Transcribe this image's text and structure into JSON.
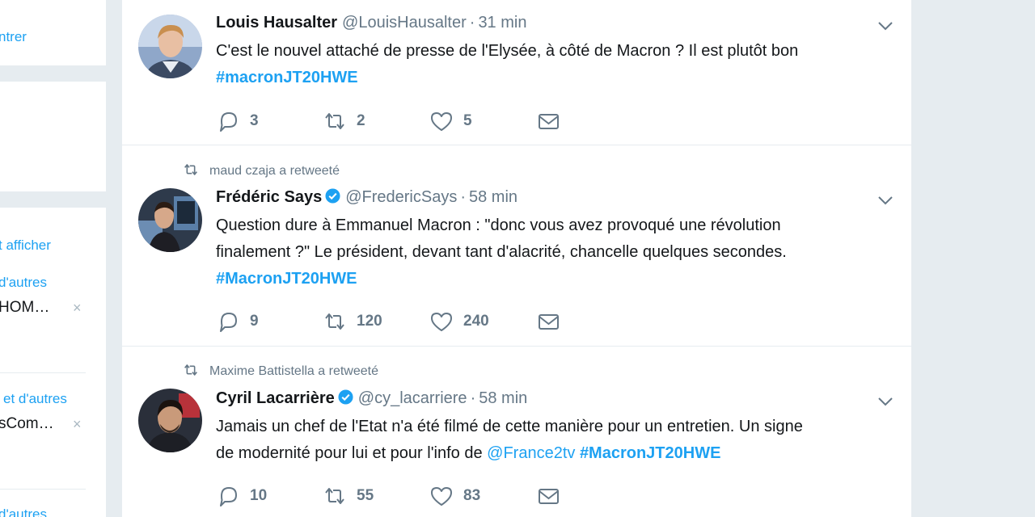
{
  "sidebar": {
    "card1": {
      "link": "ntrer"
    },
    "card3": {
      "link_show": "t afficher",
      "item1_meta": "d'autres",
      "item1_name": "HOM…",
      "item2_meta": "et d'autres",
      "item2_name": "sCom…",
      "item3_meta": "d'autres",
      "dismiss": "×"
    }
  },
  "tweets": [
    {
      "retweeted_by": "",
      "name": "Louis Hausalter",
      "verified": false,
      "handle": "@LouisHausalter",
      "time": "31 min",
      "text_lines": [
        "C'est le nouvel attaché de presse de l'Elysée, à côté de Macron ? Il est plutôt bon"
      ],
      "hashtag": "#macronJT20HWE",
      "replies": "3",
      "retweets": "2",
      "likes": "5"
    },
    {
      "retweeted_by": "maud czaja a retweeté",
      "name": "Frédéric Says",
      "verified": true,
      "handle": "@FredericSays",
      "time": "58 min",
      "text_lines": [
        "Question dure à Emmanuel Macron : \"donc vous avez provoqué une révolution",
        "finalement ?\" Le président, devant tant d'alacrité, chancelle quelques secondes."
      ],
      "hashtag": "#MacronJT20HWE",
      "replies": "9",
      "retweets": "120",
      "likes": "240"
    },
    {
      "retweeted_by": "Maxime Battistella a retweeté",
      "name": "Cyril Lacarrière",
      "verified": true,
      "handle": "@cy_lacarriere",
      "time": "58 min",
      "text_line1": "Jamais un chef de l'Etat n'a été filmé de cette manière pour un entretien. Un signe",
      "text_line2_pre": "de modernité pour lui et pour l'info de ",
      "mention": "@France2tv",
      "hashtag": "#MacronJT20HWE",
      "replies": "10",
      "retweets": "55",
      "likes": "83"
    }
  ],
  "separator": "·",
  "colors": {
    "accent": "#1da1f2",
    "muted": "#657786",
    "background": "#e6ecf0"
  },
  "icons": [
    "reply-icon",
    "retweet-icon",
    "like-icon",
    "message-icon",
    "caret-down-icon",
    "verified-icon"
  ]
}
